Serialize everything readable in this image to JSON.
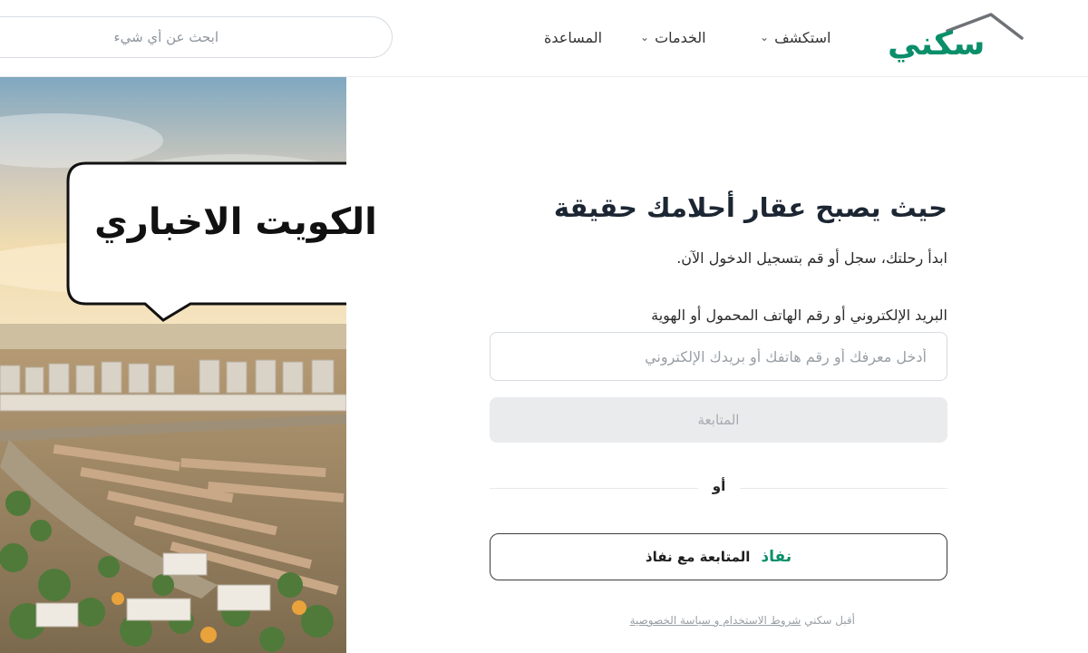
{
  "header": {
    "logo_text": "سكني",
    "nav": [
      {
        "label": "استكشف",
        "has_dropdown": true
      },
      {
        "label": "الخدمات",
        "has_dropdown": true
      },
      {
        "label": "المساعدة",
        "has_dropdown": false
      }
    ],
    "search": {
      "placeholder": "ابحث عن أي شيء"
    }
  },
  "hero": {
    "watermark": "الكويت الاخباري"
  },
  "form": {
    "headline": "حيث يصبح عقار أحلامك حقيقة",
    "subline": "ابدأ رحلتك، سجل أو قم بتسجيل الدخول الآن.",
    "field_label": "البريد الإلكتروني أو رقم الهاتف المحمول أو الهوية",
    "field_placeholder": "أدخل معرفك أو رقم هاتفك أو بريدك الإلكتروني",
    "continue_label": "المتابعة",
    "or_label": "أو",
    "nafath_brand": "نفاذ",
    "nafath_label": "المتابعة مع نفاذ",
    "terms_prefix": "أقبل سكني",
    "terms_link": "شروط الاستخدام و سياسة الخصوصية"
  },
  "colors": {
    "brand_green": "#0a8f6a",
    "button_disabled_bg": "#e9ebed",
    "text_dark": "#1c2633"
  }
}
